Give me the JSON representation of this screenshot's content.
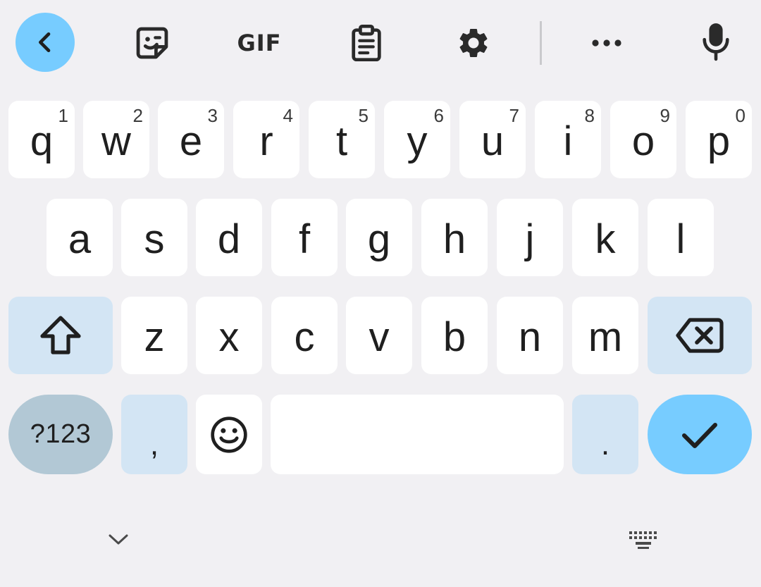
{
  "toolbar": {
    "back_icon": "chevron-left-icon",
    "sticker_icon": "sticker-icon",
    "gif_label": "GIF",
    "clipboard_icon": "clipboard-icon",
    "settings_icon": "gear-icon",
    "more_icon": "more-horizontal-icon",
    "mic_icon": "microphone-icon"
  },
  "rows": {
    "row1": [
      {
        "letter": "q",
        "hint": "1"
      },
      {
        "letter": "w",
        "hint": "2"
      },
      {
        "letter": "e",
        "hint": "3"
      },
      {
        "letter": "r",
        "hint": "4"
      },
      {
        "letter": "t",
        "hint": "5"
      },
      {
        "letter": "y",
        "hint": "6"
      },
      {
        "letter": "u",
        "hint": "7"
      },
      {
        "letter": "i",
        "hint": "8"
      },
      {
        "letter": "o",
        "hint": "9"
      },
      {
        "letter": "p",
        "hint": "0"
      }
    ],
    "row2": [
      "a",
      "s",
      "d",
      "f",
      "g",
      "h",
      "j",
      "k",
      "l"
    ],
    "row3": [
      "z",
      "x",
      "c",
      "v",
      "b",
      "n",
      "m"
    ]
  },
  "bottom_row": {
    "symbols_label": "?123",
    "comma_label": ",",
    "period_label": ".",
    "space_label": ""
  },
  "colors": {
    "background": "#f1f0f3",
    "key": "#ffffff",
    "function_key": "#d3e5f4",
    "symbols_key": "#b2c8d5",
    "accent": "#77ccff"
  },
  "nav": {
    "hide_icon": "chevron-down-icon",
    "switch_keyboard_icon": "keyboard-icon"
  }
}
